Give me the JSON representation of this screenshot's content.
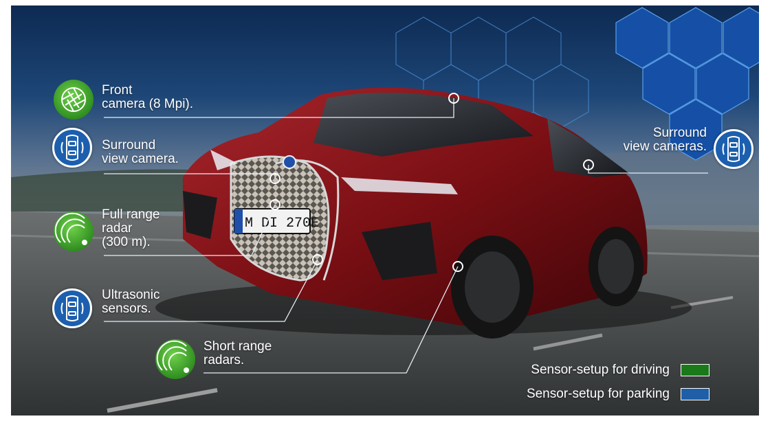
{
  "labels": {
    "front_camera": "Front\ncamera (8 Mpi).",
    "surround_view_camera": "Surround\nview camera.",
    "full_range_radar": "Full range\nradar\n(300 m).",
    "ultrasonic_sensors": "Ultrasonic\nsensors.",
    "short_range_radars": "Short range\nradars.",
    "surround_view_cameras": "Surround\nview cameras."
  },
  "license_plate": "M DI 270E",
  "legend": {
    "driving_label": "Sensor-setup for driving",
    "driving_color": "#1a7a1a",
    "parking_label": "Sensor-setup for parking",
    "parking_color": "#1f5fa8"
  },
  "icons": {
    "front_camera": "camera-aperture-icon",
    "surround_view_camera": "car-top-view-icon",
    "full_range_radar": "radar-icon",
    "ultrasonic_sensors": "car-top-view-icon",
    "short_range_radars": "radar-icon",
    "surround_view_cameras": "car-top-view-icon"
  },
  "colors": {
    "driving_green": "#3fa52c",
    "parking_blue": "#1c5fae",
    "car_red": "#7a0f14"
  }
}
